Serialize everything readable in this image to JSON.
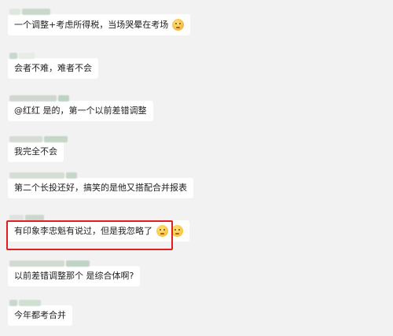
{
  "messages": [
    {
      "text": "一个调整+考虑所得税，当场哭晕在考场",
      "emoji": "facepalm-face"
    },
    {
      "text": "会者不难，难者不会"
    },
    {
      "text": "@红红  是的，第一个以前差错调整"
    },
    {
      "text": "我完全不会"
    },
    {
      "text": "第二个长投还好，搞笑的是他又搭配合并报表"
    },
    {
      "text": "有印象李忠魁有说过，但是我忽略了",
      "emoji": "sweat-face",
      "emoji2": "sweat-face",
      "highlighted": true
    },
    {
      "text": "以前差错调整那个 是综合体啊?"
    },
    {
      "text": "今年都考合并"
    }
  ],
  "colors": {
    "background": "#f2f2f2",
    "bubble": "#ffffff",
    "highlight_border": "#e02020",
    "name_blur": [
      "#c9d8cc",
      "#dfe6df",
      "#b9cfc0"
    ]
  }
}
